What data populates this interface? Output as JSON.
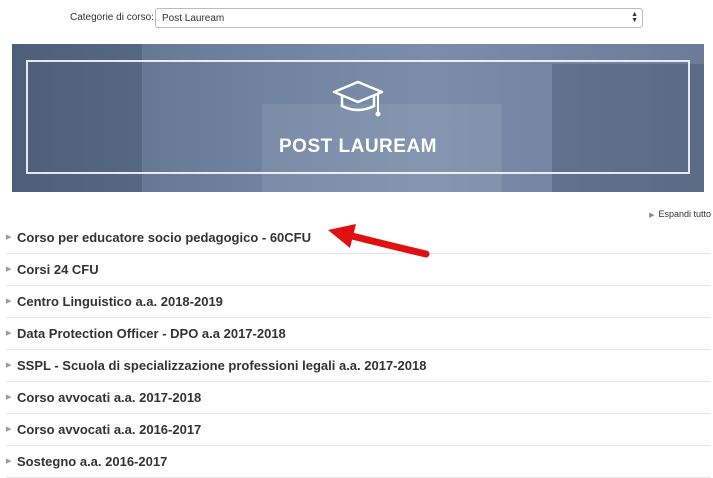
{
  "filter": {
    "label": "Categorie di corso:",
    "selected": "Post Lauream"
  },
  "banner": {
    "title": "POST LAUREAM",
    "icon": "graduation-cap-icon"
  },
  "expand_all": "Espandi tutto",
  "courses": [
    "Corso per educatore socio pedagogico - 60CFU",
    "Corsi 24 CFU",
    "Centro Linguistico a.a. 2018-2019",
    "Data Protection Officer - DPO a.a 2017-2018",
    "SSPL - Scuola di specializzazione professioni legali a.a. 2017-2018",
    "Corso avvocati a.a. 2017-2018",
    "Corso avvocati a.a. 2016-2017",
    "Sostegno a.a. 2016-2017"
  ],
  "colors": {
    "arrow": "#e01010",
    "banner": "#6f82a0"
  }
}
